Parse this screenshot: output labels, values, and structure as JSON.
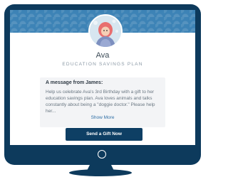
{
  "profile": {
    "name": "Ava",
    "plan_label": "EDUCATION SAVINGS PLAN",
    "avatar_icon": "child-photo-icon"
  },
  "message": {
    "title": "A message from James:",
    "body": "Help us celebrate Ava's 3rd Birthday with a gift to her education savings plan. Ava loves animals and talks constantly about being a \"doggie doctor.\" Please help her...",
    "show_more": "Show More"
  },
  "actions": {
    "gift_button": "Send a Gift Now"
  },
  "icons": {
    "power": "power-button-icon"
  },
  "colors": {
    "monitor": "#0d3a5c",
    "banner": "#3d83b6",
    "button": "#0e3f64",
    "link": "#2f6fa6"
  }
}
